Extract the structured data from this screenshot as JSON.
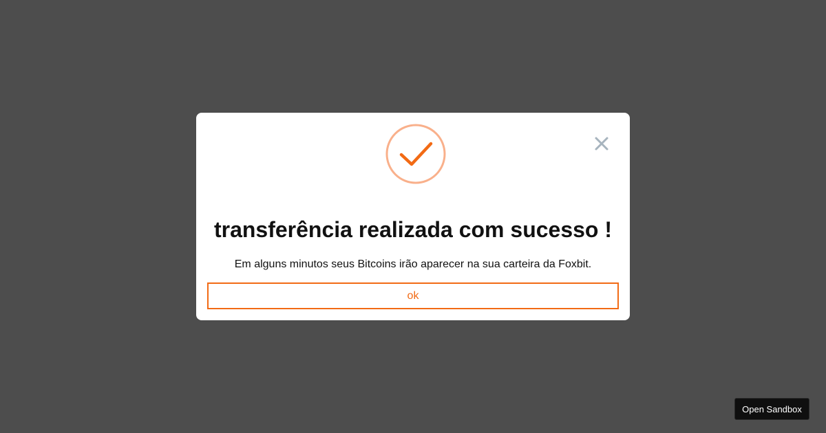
{
  "modal": {
    "icon": "check-circle-icon",
    "close_icon": "close-icon",
    "title": "transferência realizada com sucesso !",
    "message": "Em alguns minutos seus Bitcoins irão aparecer na sua carteira da Foxbit.",
    "ok_label": "ok"
  },
  "sandbox": {
    "label": "Open Sandbox"
  },
  "colors": {
    "backdrop": "#4d4d4d",
    "accent": "#f26a14",
    "icon_ring": "#f9b08b",
    "close_icon": "#a7b4be",
    "text": "#111111",
    "sandbox_bg": "#0f0f0f"
  }
}
